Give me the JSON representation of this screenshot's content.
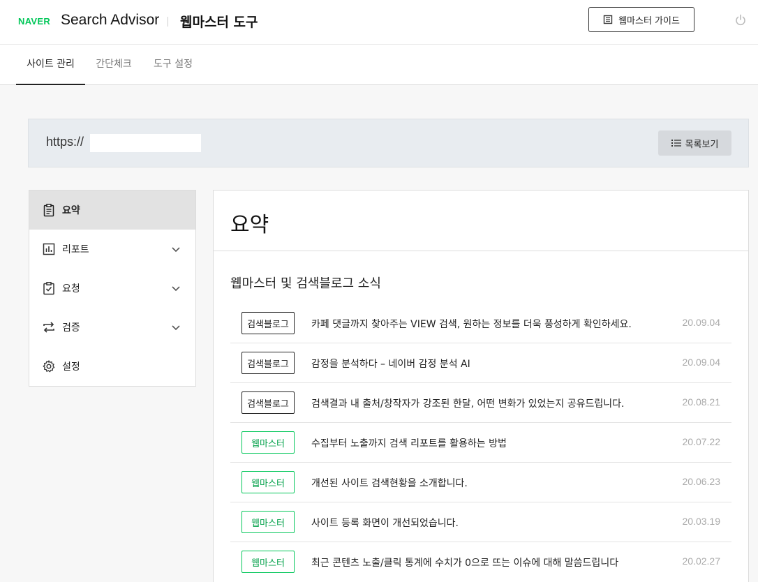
{
  "header": {
    "logo_text": "NAVER",
    "brand": "Search Advisor",
    "tool_title": "웹마스터 도구",
    "guide_button": "웹마스터 가이드",
    "guide_icon": "book-icon",
    "power_icon": "power-icon"
  },
  "tabs": [
    {
      "label": "사이트 관리",
      "active": true
    },
    {
      "label": "간단체크",
      "active": false
    },
    {
      "label": "도구 설정",
      "active": false
    }
  ],
  "site": {
    "url_prefix": "https://",
    "list_button": "목록보기"
  },
  "sidebar": {
    "items": [
      {
        "label": "요약",
        "icon": "clipboard-icon",
        "active": true,
        "expandable": false
      },
      {
        "label": "리포트",
        "icon": "chart-icon",
        "active": false,
        "expandable": true
      },
      {
        "label": "요청",
        "icon": "clipboard-check-icon",
        "active": false,
        "expandable": true
      },
      {
        "label": "검증",
        "icon": "swap-icon",
        "active": false,
        "expandable": true
      },
      {
        "label": "설정",
        "icon": "gear-icon",
        "active": false,
        "expandable": false
      }
    ]
  },
  "main": {
    "title": "요약",
    "section_title": "웹마스터 및 검색블로그 소식",
    "news": [
      {
        "category": "검색블로그",
        "title": "카페 댓글까지 찾아주는 VIEW 검색, 원하는 정보를 더욱 풍성하게 확인하세요.",
        "date": "20.09.04"
      },
      {
        "category": "검색블로그",
        "title": "감정을 분석하다 – 네이버 감정 분석 AI",
        "date": "20.09.04"
      },
      {
        "category": "검색블로그",
        "title": "검색결과 내 출처/창작자가 강조된 한달, 어떤 변화가 있었는지 공유드립니다.",
        "date": "20.08.21"
      },
      {
        "category": "웹마스터",
        "title": "수집부터 노출까지 검색 리포트를 활용하는 방법",
        "date": "20.07.22"
      },
      {
        "category": "웹마스터",
        "title": "개선된 사이트 검색현황을 소개합니다.",
        "date": "20.06.23"
      },
      {
        "category": "웹마스터",
        "title": "사이트 등록 화면이 개선되었습니다.",
        "date": "20.03.19"
      },
      {
        "category": "웹마스터",
        "title": "최근 콘텐츠 노출/클릭 통계에 수치가 0으로 뜨는 이슈에 대해 말씀드립니다",
        "date": "20.02.27"
      }
    ]
  },
  "colors": {
    "naver_green": "#03c75a",
    "webmaster_badge": "#03a14a",
    "date_gray": "#aaaaaa"
  }
}
